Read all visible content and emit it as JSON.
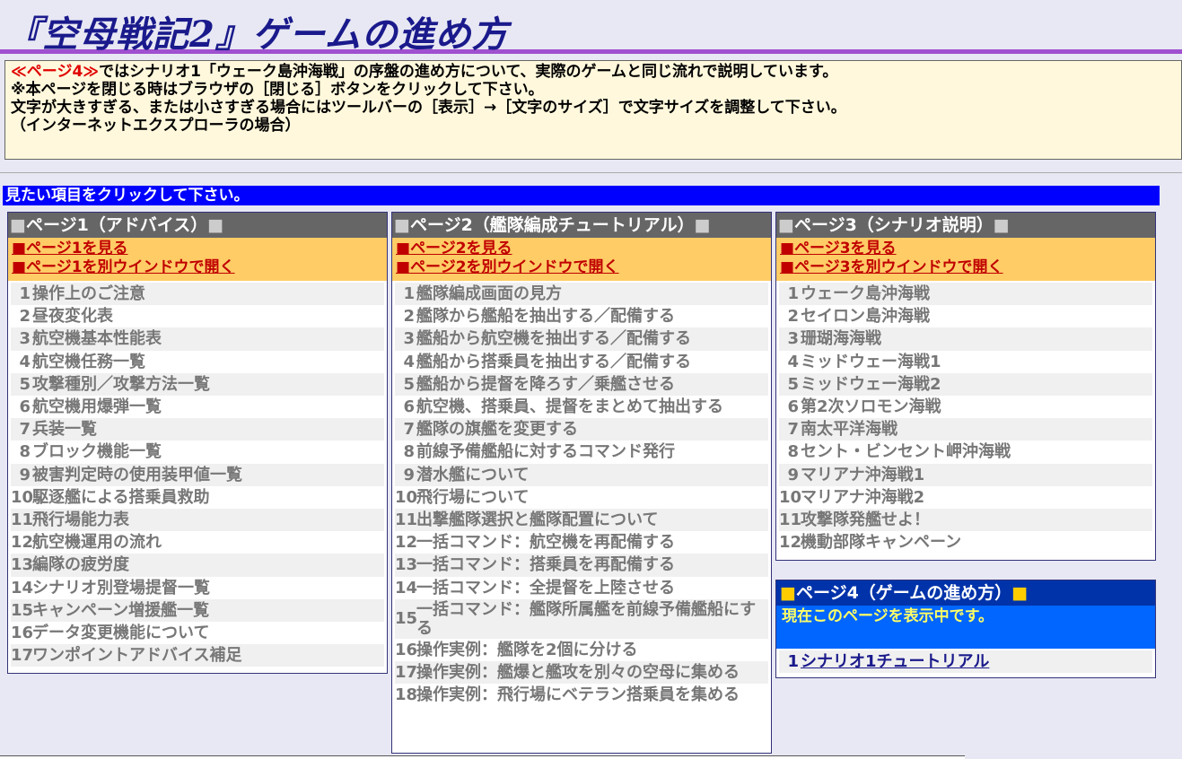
{
  "title": "『空母戦記2』ゲームの進め方",
  "intro": {
    "line1_highlight": "≪ページ4≫",
    "line1_rest": "ではシナリオ1「ウェーク島沖海戦」の序盤の進め方について、実際のゲームと同じ流れで説明しています。",
    "line2": "※本ページを閉じる時はブラウザの［閉じる］ボタンをクリックして下さい。",
    "line3": "文字が大きすぎる、または小さすぎる場合にはツールバーの［表示］→［文字のサイズ］で文字サイズを調整して下さい。",
    "line4": "（インターネットエクスプローラの場合）"
  },
  "click_prompt": "見たい項目をクリックして下さい。",
  "square": "■",
  "page1": {
    "head": "ページ1（アドバイス）",
    "link_view": "ページ1を見る",
    "link_window": "ページ1を別ウインドウで開く",
    "items": [
      {
        "n": "1",
        "t": "操作上のご注意"
      },
      {
        "n": "2",
        "t": "昼夜変化表"
      },
      {
        "n": "3",
        "t": "航空機基本性能表"
      },
      {
        "n": "4",
        "t": "航空機任務一覧"
      },
      {
        "n": "5",
        "t": "攻撃種別／攻撃方法一覧"
      },
      {
        "n": "6",
        "t": "航空機用爆弾一覧"
      },
      {
        "n": "7",
        "t": "兵装一覧"
      },
      {
        "n": "8",
        "t": "ブロック機能一覧"
      },
      {
        "n": "9",
        "t": "被害判定時の使用装甲値一覧"
      },
      {
        "n": "10",
        "t": "駆逐艦による搭乗員救助"
      },
      {
        "n": "11",
        "t": "飛行場能力表"
      },
      {
        "n": "12",
        "t": "航空機運用の流れ"
      },
      {
        "n": "13",
        "t": "編隊の疲労度"
      },
      {
        "n": "14",
        "t": "シナリオ別登場提督一覧"
      },
      {
        "n": "15",
        "t": "キャンペーン増援艦一覧"
      },
      {
        "n": "16",
        "t": "データ変更機能について"
      },
      {
        "n": "17",
        "t": "ワンポイントアドバイス補足"
      }
    ]
  },
  "page2": {
    "head": "ページ2（艦隊編成チュートリアル）",
    "link_view": "ページ2を見る",
    "link_window": "ページ2を別ウインドウで開く",
    "items": [
      {
        "n": "1",
        "t": "艦隊編成画面の見方"
      },
      {
        "n": "2",
        "t": "艦隊から艦船を抽出する／配備する"
      },
      {
        "n": "3",
        "t": "艦船から航空機を抽出する／配備する"
      },
      {
        "n": "4",
        "t": "艦船から搭乗員を抽出する／配備する"
      },
      {
        "n": "5",
        "t": "艦船から提督を降ろす／乗艦させる"
      },
      {
        "n": "6",
        "t": "航空機、搭乗員、提督をまとめて抽出する"
      },
      {
        "n": "7",
        "t": "艦隊の旗艦を変更する"
      },
      {
        "n": "8",
        "t": "前線予備艦船に対するコマンド発行"
      },
      {
        "n": "9",
        "t": "潜水艦について"
      },
      {
        "n": "10",
        "t": "飛行場について"
      },
      {
        "n": "11",
        "t": "出撃艦隊選択と艦隊配置について"
      },
      {
        "n": "12",
        "t": "一括コマンド：航空機を再配備する"
      },
      {
        "n": "13",
        "t": "一括コマンド：搭乗員を再配備する"
      },
      {
        "n": "14",
        "t": "一括コマンド：全提督を上陸させる"
      },
      {
        "n": "15",
        "t": "一括コマンド：艦隊所属艦を前線予備艦船にする"
      },
      {
        "n": "16",
        "t": "操作実例：艦隊を2個に分ける"
      },
      {
        "n": "17",
        "t": "操作実例：艦爆と艦攻を別々の空母に集める"
      },
      {
        "n": "18",
        "t": "操作実例：飛行場にベテラン搭乗員を集める"
      }
    ]
  },
  "page3": {
    "head": "ページ3（シナリオ説明）",
    "link_view": "ページ3を見る",
    "link_window": "ページ3を別ウインドウで開く",
    "items": [
      {
        "n": "1",
        "t": "ウェーク島沖海戦"
      },
      {
        "n": "2",
        "t": "セイロン島沖海戦"
      },
      {
        "n": "3",
        "t": "珊瑚海海戦"
      },
      {
        "n": "4",
        "t": "ミッドウェー海戦1"
      },
      {
        "n": "5",
        "t": "ミッドウェー海戦2"
      },
      {
        "n": "6",
        "t": "第2次ソロモン海戦"
      },
      {
        "n": "7",
        "t": "南太平洋海戦"
      },
      {
        "n": "8",
        "t": "セント・ビンセント岬沖海戦"
      },
      {
        "n": "9",
        "t": "マリアナ沖海戦1"
      },
      {
        "n": "10",
        "t": "マリアナ沖海戦2"
      },
      {
        "n": "11",
        "t": "攻撃隊発艦せよ！"
      },
      {
        "n": "12",
        "t": "機動部隊キャンペーン"
      }
    ]
  },
  "page4": {
    "head": "ページ4（ゲームの進め方）",
    "status": "現在このページを表示中です。",
    "items": [
      {
        "n": "1",
        "t": "シナリオ1チュートリアル"
      }
    ]
  }
}
